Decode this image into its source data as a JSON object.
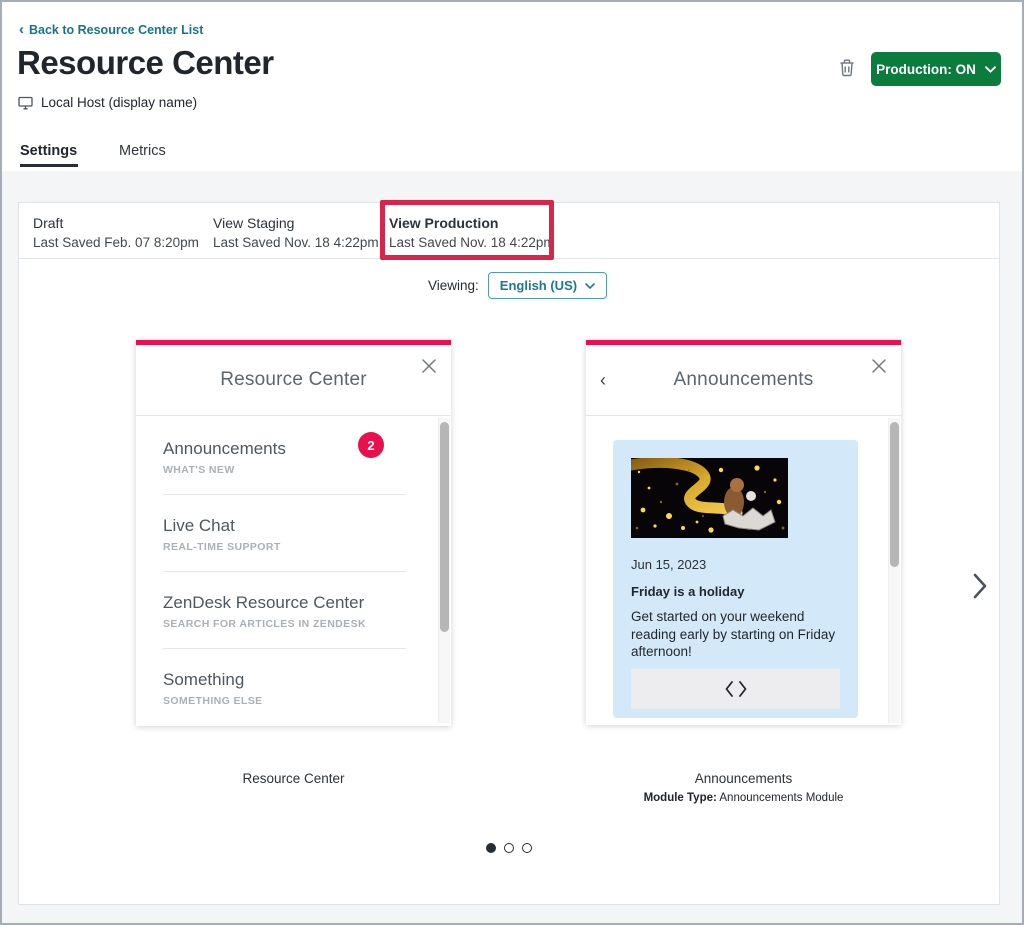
{
  "header": {
    "back_link": "Back to Resource Center List",
    "title": "Resource Center",
    "host": "Local Host (display name)",
    "production_button": "Production: ON"
  },
  "tabs": [
    {
      "label": "Settings",
      "active": true
    },
    {
      "label": "Metrics",
      "active": false
    }
  ],
  "versions": [
    {
      "label": "Draft",
      "saved": "Last Saved Feb. 07 8:20pm",
      "highlighted": false
    },
    {
      "label": "View Staging",
      "saved": "Last Saved Nov. 18 4:22pm",
      "highlighted": false
    },
    {
      "label": "View Production",
      "saved": "Last Saved Nov. 18 4:22pm",
      "highlighted": true
    }
  ],
  "viewing": {
    "label": "Viewing:",
    "language": "English (US)"
  },
  "preview": {
    "resource_center_card": {
      "title": "Resource Center",
      "items": [
        {
          "title": "Announcements",
          "subtitle": "WHAT'S NEW",
          "badge": "2"
        },
        {
          "title": "Live Chat",
          "subtitle": "REAL-TIME SUPPORT"
        },
        {
          "title": "ZenDesk Resource Center",
          "subtitle": "SEARCH FOR ARTICLES IN ZENDESK"
        },
        {
          "title": "Something",
          "subtitle": "SOMETHING ELSE"
        }
      ],
      "caption": "Resource Center"
    },
    "announcements_card": {
      "title": "Announcements",
      "announcement": {
        "date": "Jun 15, 2023",
        "headline": "Friday is a holiday",
        "body": "Get started on your weekend reading early by starting on Friday afternoon!"
      },
      "caption": "Announcements",
      "module_type_label": "Module Type:",
      "module_type_value": "Announcements Module"
    },
    "pagination": {
      "dots": 3,
      "active": 1
    }
  },
  "icons": {
    "back_chevron": "‹",
    "close": "✕",
    "chevron_down": "⌄",
    "next_chevron": "›",
    "code_brackets": "<>"
  },
  "colors": {
    "accent_teal": "#17758a",
    "production_green": "#0c7c3e",
    "brand_red": "#e8104e",
    "annotation_red": "#d8254c",
    "announcement_blue": "#d3e9fa"
  }
}
